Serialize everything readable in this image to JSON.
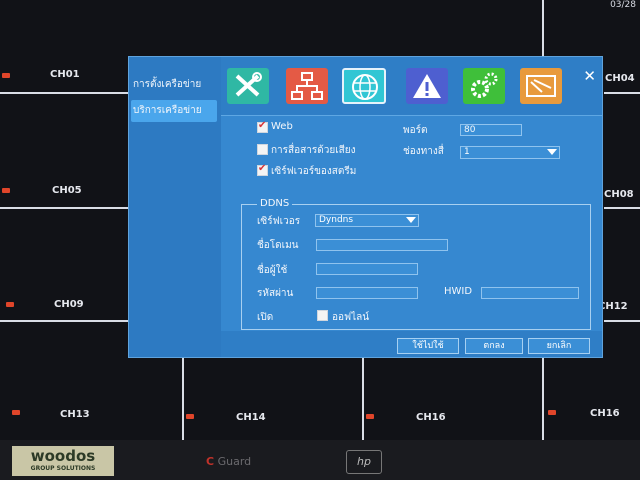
{
  "dvr": {
    "clock": "03/28",
    "channels": [
      "CH01",
      "CH04",
      "CH05",
      "CH08",
      "CH09",
      "CH12",
      "CH13",
      "CH14",
      "CH16",
      "CH16"
    ]
  },
  "dialog": {
    "nav": [
      "การตั้งเครือข่าย",
      "บริการเครือข่าย"
    ],
    "tabs": [
      "tools-icon",
      "network-topology-icon",
      "globe-icon",
      "warning-icon",
      "gears-icon",
      "system-icon"
    ],
    "close": "✕",
    "form": {
      "web_label": "Web",
      "port_label": "พอร์ต",
      "port_value": "80",
      "voice_label": "การสื่อสารด้วยเสียง",
      "channel_label": "ช่องทางสื่",
      "channel_value": "1",
      "stream_label": "เซิร์ฟเวอร์ของสตรีม"
    },
    "ddns": {
      "title": "DDNS",
      "server_label": "เซิร์ฟเวอร",
      "server_value": "Dyndns",
      "domain_label": "ชื่อโดเมน",
      "user_label": "ชื่อผู้ใช้",
      "password_label": "รหัสผ่าน",
      "hwid_label": "HWID",
      "enable_label": "เปิด",
      "offline_label": "ออฟไลน์"
    },
    "buttons": {
      "apply": "ใช้ไปใช้",
      "ok": "ตกลง",
      "cancel": "ยกเลิก"
    }
  },
  "bezel": {
    "sticker": "woodos",
    "sticker_sub": "GROUP SOLUTIONS",
    "brand_c": "C",
    "brand": "Guard",
    "logo": "hp"
  }
}
